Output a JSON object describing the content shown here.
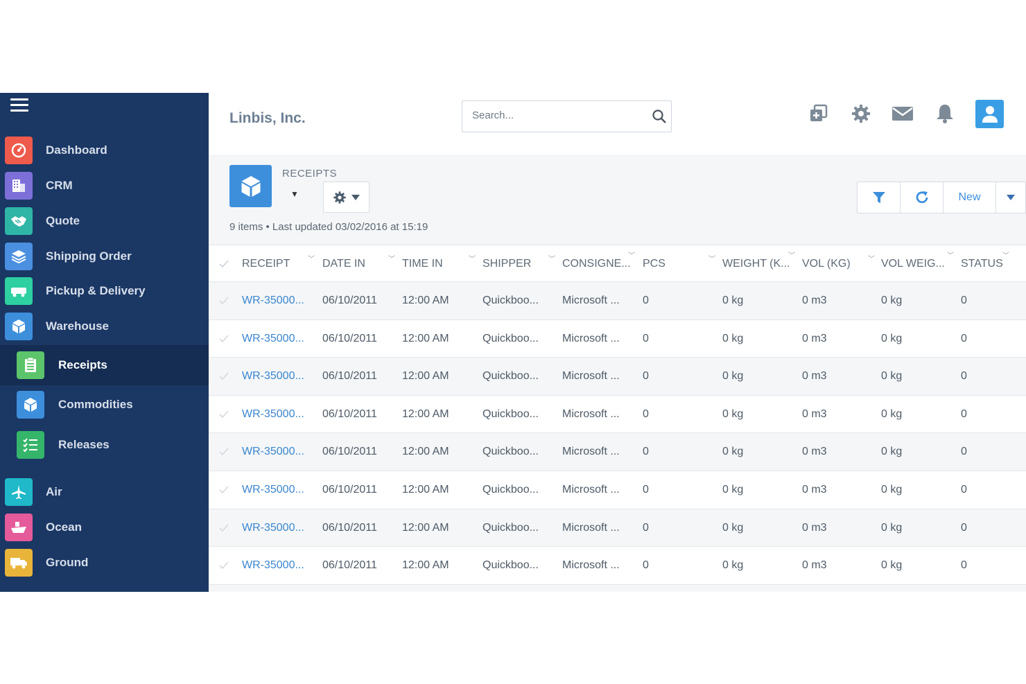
{
  "sidebar": {
    "items": [
      {
        "label": "Dashboard",
        "icon": "gauge-icon",
        "color": "#ee5a4b"
      },
      {
        "label": "CRM",
        "icon": "building-icon",
        "color": "#7d6fd8"
      },
      {
        "label": "Quote",
        "icon": "handshake-icon",
        "color": "#2fb5a6"
      },
      {
        "label": "Shipping Order",
        "icon": "layers-icon",
        "color": "#4a8fe0"
      },
      {
        "label": "Pickup & Delivery",
        "icon": "truck-icon",
        "color": "#2ecfa0"
      },
      {
        "label": "Warehouse",
        "icon": "box-icon",
        "color": "#3d8fdc"
      },
      {
        "label": "Receipts",
        "icon": "clipboard-icon",
        "color": "#5cc46a"
      },
      {
        "label": "Commodities",
        "icon": "cube-icon",
        "color": "#3d8fdc"
      },
      {
        "label": "Releases",
        "icon": "checklist-icon",
        "color": "#35b56a"
      },
      {
        "label": "Air",
        "icon": "plane-icon",
        "color": "#1fb9c9"
      },
      {
        "label": "Ocean",
        "icon": "ship-icon",
        "color": "#e45a9a"
      },
      {
        "label": "Ground",
        "icon": "ground-truck-icon",
        "color": "#e8b43a"
      }
    ]
  },
  "header": {
    "company": "Linbis, Inc.",
    "search_placeholder": "Search..."
  },
  "module": {
    "title": "RECEIPTS",
    "caret": "▼",
    "summary": "9 items • Last updated 03/02/2016 at 15:19",
    "new_label": "New"
  },
  "table": {
    "columns": [
      "RECEIPT",
      "DATE IN",
      "TIME IN",
      "SHIPPER",
      "CONSIGNE...",
      "PCS",
      "WEIGHT (K...",
      "VOL (KG)",
      "VOL WEIG...",
      "STATUS"
    ],
    "rows": [
      [
        "WR-35000...",
        "06/10/2011",
        "12:00 AM",
        "Quickboo...",
        "Microsoft ...",
        "0",
        "0 kg",
        "0 m3",
        "0 kg",
        "0"
      ],
      [
        "WR-35000...",
        "06/10/2011",
        "12:00 AM",
        "Quickboo...",
        "Microsoft ...",
        "0",
        "0 kg",
        "0 m3",
        "0 kg",
        "0"
      ],
      [
        "WR-35000...",
        "06/10/2011",
        "12:00 AM",
        "Quickboo...",
        "Microsoft ...",
        "0",
        "0 kg",
        "0 m3",
        "0 kg",
        "0"
      ],
      [
        "WR-35000...",
        "06/10/2011",
        "12:00 AM",
        "Quickboo...",
        "Microsoft ...",
        "0",
        "0 kg",
        "0 m3",
        "0 kg",
        "0"
      ],
      [
        "WR-35000...",
        "06/10/2011",
        "12:00 AM",
        "Quickboo...",
        "Microsoft ...",
        "0",
        "0 kg",
        "0 m3",
        "0 kg",
        "0"
      ],
      [
        "WR-35000...",
        "06/10/2011",
        "12:00 AM",
        "Quickboo...",
        "Microsoft ...",
        "0",
        "0 kg",
        "0 m3",
        "0 kg",
        "0"
      ],
      [
        "WR-35000...",
        "06/10/2011",
        "12:00 AM",
        "Quickboo...",
        "Microsoft ...",
        "0",
        "0 kg",
        "0 m3",
        "0 kg",
        "0"
      ],
      [
        "WR-35000...",
        "06/10/2011",
        "12:00 AM",
        "Quickboo...",
        "Microsoft ...",
        "0",
        "0 kg",
        "0 m3",
        "0 kg",
        "0"
      ]
    ]
  },
  "colors": {
    "sidebar_bg": "#1b3764",
    "accent": "#3d8fdc",
    "link": "#3a86cf"
  }
}
